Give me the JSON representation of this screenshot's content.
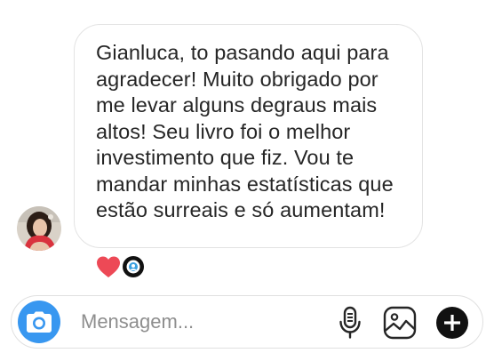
{
  "conversation": {
    "message": {
      "text": "Gianluca, to pasando aqui  para\nagradecer! Muito obrigado por\nme levar alguns degraus mais\naltos! Seu livro foi o melhor\ninvestimento que fiz. Vou te\nmandar minhas estatísticas que\nestão surreais e só aumentam!",
      "reactions": [
        "heart",
        "reactor-avatar"
      ]
    },
    "sender_avatar_icon": "avatar-photo"
  },
  "composer": {
    "placeholder": "Mensagem...",
    "camera_icon": "camera-icon",
    "mic_icon": "microphone-icon",
    "gallery_icon": "gallery-icon",
    "add_icon": "plus-circle-icon"
  },
  "colors": {
    "accent": "#3897f0",
    "heart": "#ed4956",
    "text": "#262626",
    "placeholder": "#8e8e8e",
    "border": "#e3e3e3"
  }
}
